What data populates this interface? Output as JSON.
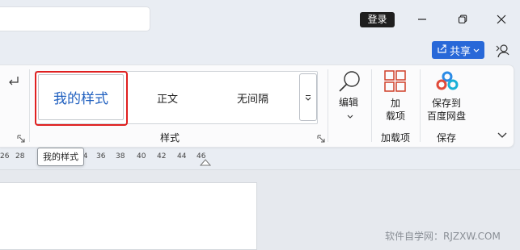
{
  "titlebar": {
    "login_label": "登录"
  },
  "share": {
    "label": "共享"
  },
  "ribbon": {
    "styles_gallery": {
      "items": [
        {
          "label": "我的样式"
        },
        {
          "label": "正文"
        },
        {
          "label": "无间隔"
        }
      ],
      "group_label": "样式"
    },
    "edit": {
      "label": "编辑"
    },
    "addins": {
      "button_label_line1": "加",
      "button_label_line2": "载项",
      "group_label": "加载项"
    },
    "save": {
      "button_label_line1": "保存到",
      "button_label_line2": "百度网盘",
      "group_label": "保存"
    }
  },
  "ruler": {
    "ticks": [
      "26",
      "28",
      "34",
      "36",
      "38",
      "40",
      "42",
      "44",
      "46"
    ]
  },
  "tooltip": {
    "text": "我的样式"
  },
  "watermark": {
    "text": "软件自学网：RJZXW.COM"
  },
  "colors": {
    "accent": "#2868d8",
    "highlight_border": "#e02020",
    "style_text": "#1f5fbf",
    "addin_icon": "#d0402a"
  }
}
